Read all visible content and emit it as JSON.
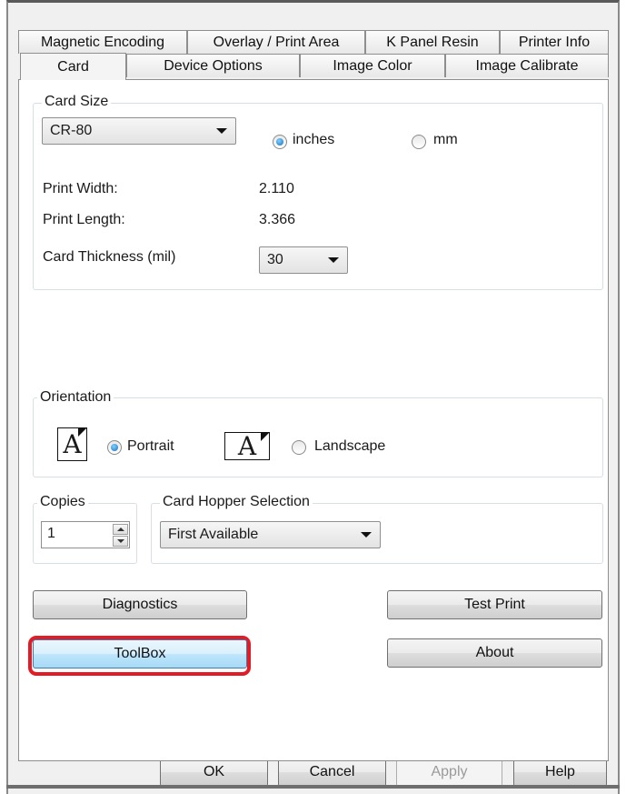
{
  "tabs_row1": [
    "Magnetic Encoding",
    "Overlay / Print Area",
    "K Panel Resin",
    "Printer Info"
  ],
  "tabs_row2": [
    "Card",
    "Device Options",
    "Image Color",
    "Image Calibrate"
  ],
  "card_size": {
    "legend": "Card Size",
    "size_value": "CR-80",
    "unit_inches": "inches",
    "unit_mm": "mm",
    "selected_unit": "inches",
    "print_width_label": "Print Width:",
    "print_width_value": "2.110",
    "print_length_label": "Print Length:",
    "print_length_value": "3.366",
    "thickness_label": "Card Thickness (mil)",
    "thickness_value": "30"
  },
  "orientation": {
    "legend": "Orientation",
    "portrait_label": "Portrait",
    "landscape_label": "Landscape",
    "icon_letter": "A",
    "selected": "Portrait"
  },
  "copies": {
    "legend": "Copies",
    "value": "1"
  },
  "hopper": {
    "legend": "Card Hopper Selection",
    "value": "First Available"
  },
  "buttons": {
    "diagnostics": "Diagnostics",
    "test_print": "Test Print",
    "toolbox": "ToolBox",
    "about": "About"
  },
  "footer": {
    "ok": "OK",
    "cancel": "Cancel",
    "apply": "Apply",
    "help": "Help"
  },
  "colors": {
    "highlight": "#e31b24",
    "radio_selected": "#1b6fb8"
  }
}
